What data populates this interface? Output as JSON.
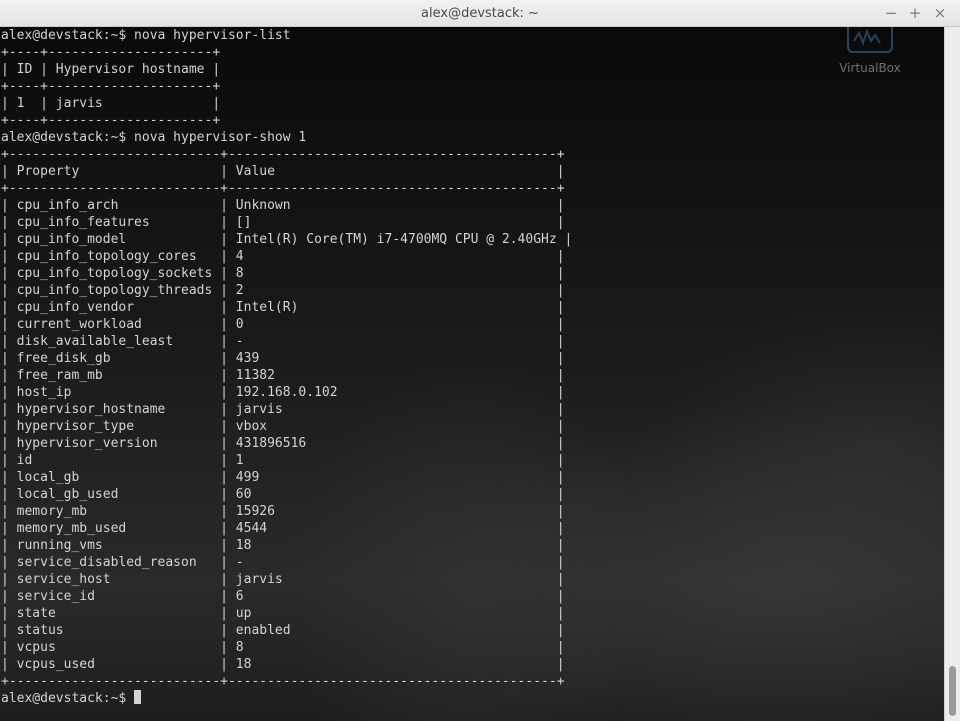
{
  "window": {
    "title": "alex@devstack: ~",
    "buttons": {
      "minimize": "−",
      "maximize": "+",
      "close": "×"
    }
  },
  "desktop": {
    "virtualbox_label": "VirtualBox"
  },
  "terminal": {
    "prompt": "alex@devstack:~$",
    "lines": [
      "alex@devstack:~$ nova hypervisor-list",
      "+----+---------------------+",
      "| ID | Hypervisor hostname |",
      "+----+---------------------+",
      "| 1  | jarvis              |",
      "+----+---------------------+",
      "alex@devstack:~$ nova hypervisor-show 1",
      "+---------------------------+------------------------------------------+",
      "| Property                  | Value                                    |",
      "+---------------------------+------------------------------------------+",
      "| cpu_info_arch             | Unknown                                  |",
      "| cpu_info_features         | []                                       |",
      "| cpu_info_model            | Intel(R) Core(TM) i7-4700MQ CPU @ 2.40GHz |",
      "| cpu_info_topology_cores   | 4                                        |",
      "| cpu_info_topology_sockets | 8                                        |",
      "| cpu_info_topology_threads | 2                                        |",
      "| cpu_info_vendor           | Intel(R)                                 |",
      "| current_workload          | 0                                        |",
      "| disk_available_least      | -                                        |",
      "| free_disk_gb              | 439                                      |",
      "| free_ram_mb               | 11382                                    |",
      "| host_ip                   | 192.168.0.102                            |",
      "| hypervisor_hostname       | jarvis                                   |",
      "| hypervisor_type           | vbox                                     |",
      "| hypervisor_version        | 431896516                                |",
      "| id                        | 1                                        |",
      "| local_gb                  | 499                                      |",
      "| local_gb_used             | 60                                       |",
      "| memory_mb                 | 15926                                    |",
      "| memory_mb_used            | 4544                                     |",
      "| running_vms               | 18                                       |",
      "| service_disabled_reason   | -                                        |",
      "| service_host              | jarvis                                   |",
      "| service_id                | 6                                        |",
      "| state                     | up                                       |",
      "| status                    | enabled                                  |",
      "| vcpus                     | 8                                        |",
      "| vcpus_used                | 18                                       |",
      "+---------------------------+------------------------------------------+"
    ]
  },
  "colors": {
    "terminal_text": "#d3d3d3",
    "titlebar_bg": "#ececec"
  }
}
